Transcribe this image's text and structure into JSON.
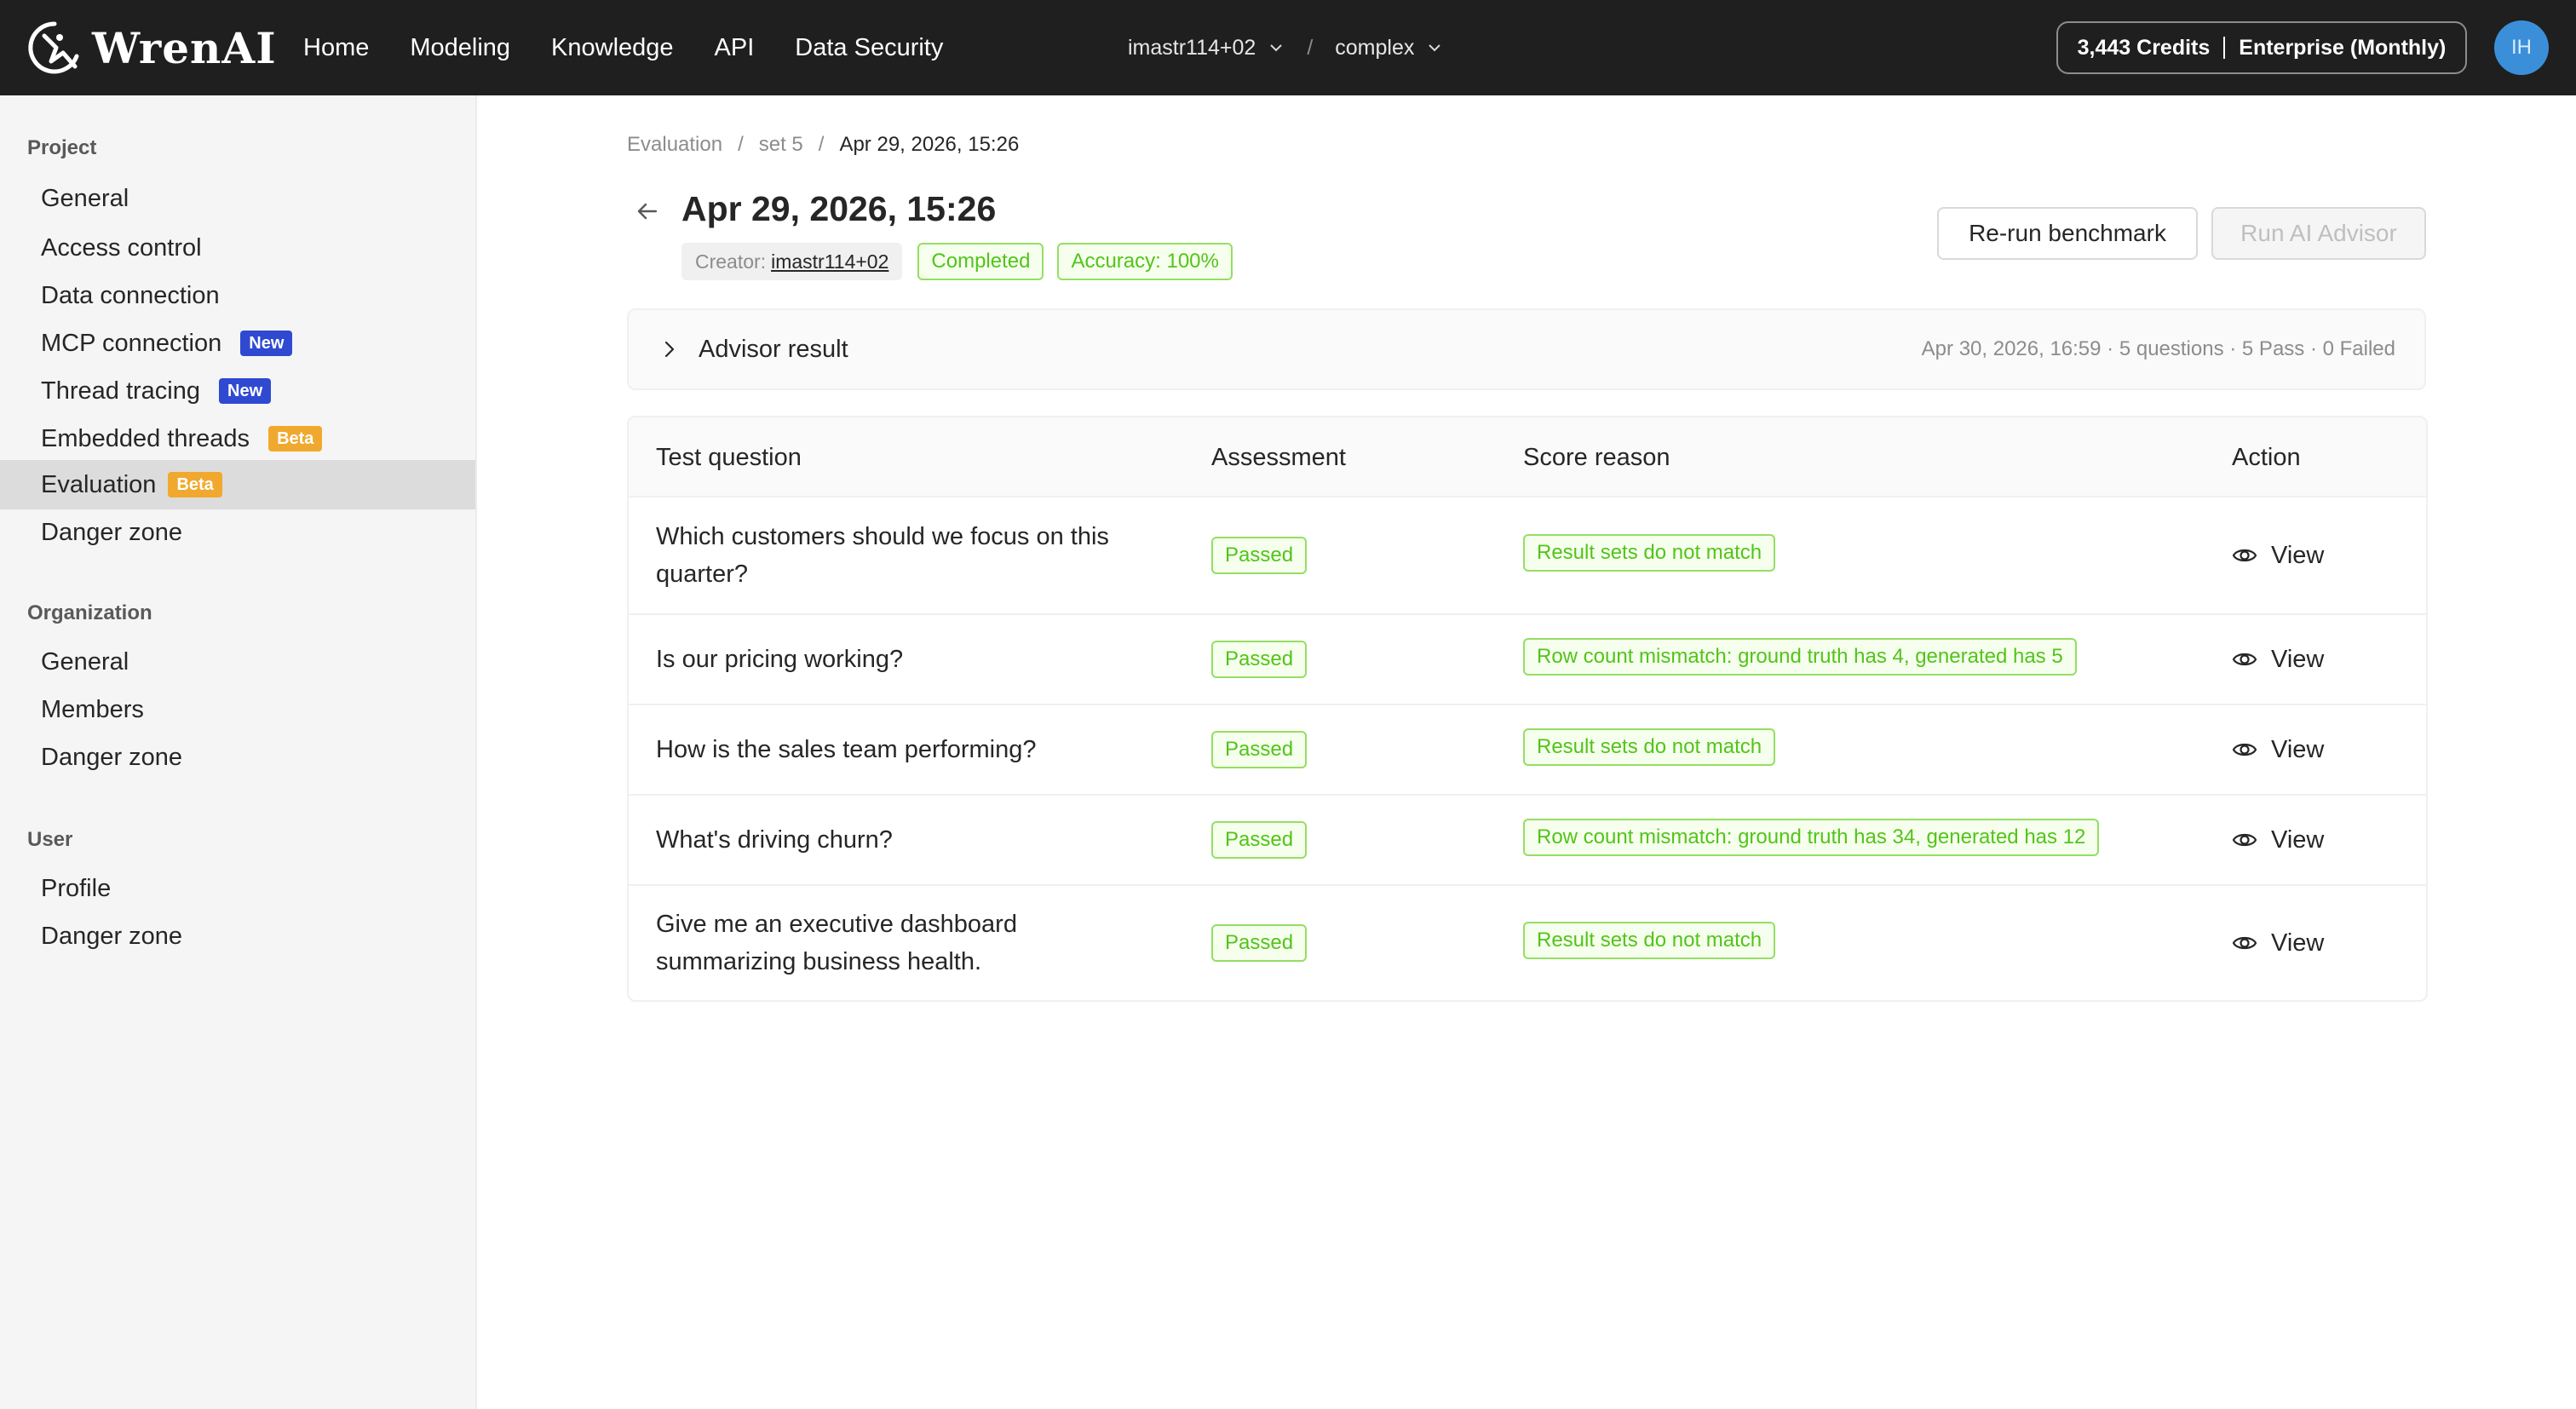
{
  "app": {
    "brand": "WrenAI"
  },
  "nav": {
    "items": [
      "Home",
      "Modeling",
      "Knowledge",
      "API",
      "Data Security"
    ]
  },
  "workspace": {
    "user": "imastr114+02",
    "project": "complex"
  },
  "account": {
    "credits": "3,443 Credits",
    "plan": "Enterprise (Monthly)",
    "avatar_initials": "IH"
  },
  "sidebar": {
    "project_heading": "Project",
    "project_items": [
      {
        "label": "General",
        "tag": ""
      },
      {
        "label": "Access control",
        "tag": ""
      },
      {
        "label": "Data connection",
        "tag": ""
      },
      {
        "label": "MCP connection",
        "tag": "New"
      },
      {
        "label": "Thread tracing",
        "tag": "New"
      },
      {
        "label": "Embedded threads",
        "tag": "Beta"
      },
      {
        "label": "Evaluation",
        "tag": "Beta"
      },
      {
        "label": "Danger zone",
        "tag": ""
      }
    ],
    "organization_heading": "Organization",
    "organization_items": [
      "General",
      "Members",
      "Danger zone"
    ],
    "user_heading": "User",
    "user_items": [
      "Profile",
      "Danger zone"
    ]
  },
  "breadcrumb": {
    "root": "Evaluation",
    "set": "set 5",
    "current": "Apr 29, 2026, 15:26"
  },
  "header": {
    "title": "Apr 29, 2026, 15:26",
    "creator_label": "Creator:",
    "creator": "imastr114+02",
    "status": "Completed",
    "accuracy": "Accuracy: 100%",
    "rerun_label": "Re-run benchmark",
    "advisor_label": "Run AI Advisor"
  },
  "advisor_result": {
    "label": "Advisor result",
    "stats": "Apr 30, 2026, 16:59 · 5 questions · 5 Pass · 0 Failed"
  },
  "table": {
    "columns": [
      "Test question",
      "Assessment",
      "Score reason",
      "Action"
    ],
    "rows": [
      {
        "question": "Which customers should we focus on this quarter?",
        "assessment": "Passed",
        "reason": "Result sets do not match",
        "action": "View"
      },
      {
        "question": "Is our pricing working?",
        "assessment": "Passed",
        "reason": "Row count mismatch: ground truth has 4, generated has 5",
        "action": "View"
      },
      {
        "question": "How is the sales team performing?",
        "assessment": "Passed",
        "reason": "Result sets do not match",
        "action": "View"
      },
      {
        "question": "What's driving churn?",
        "assessment": "Passed",
        "reason": "Row count mismatch: ground truth has 34, generated has 12",
        "action": "View"
      },
      {
        "question": "Give me an executive dashboard summarizing business health.",
        "assessment": "Passed",
        "reason": "Result sets do not match",
        "action": "View"
      }
    ]
  },
  "colors": {
    "topbar_bg": "#1f1f1f",
    "success": "#52c41a",
    "tag_new": "#2f49d1",
    "tag_beta": "#f0a92e",
    "avatar_bg": "#3b8fd9"
  }
}
